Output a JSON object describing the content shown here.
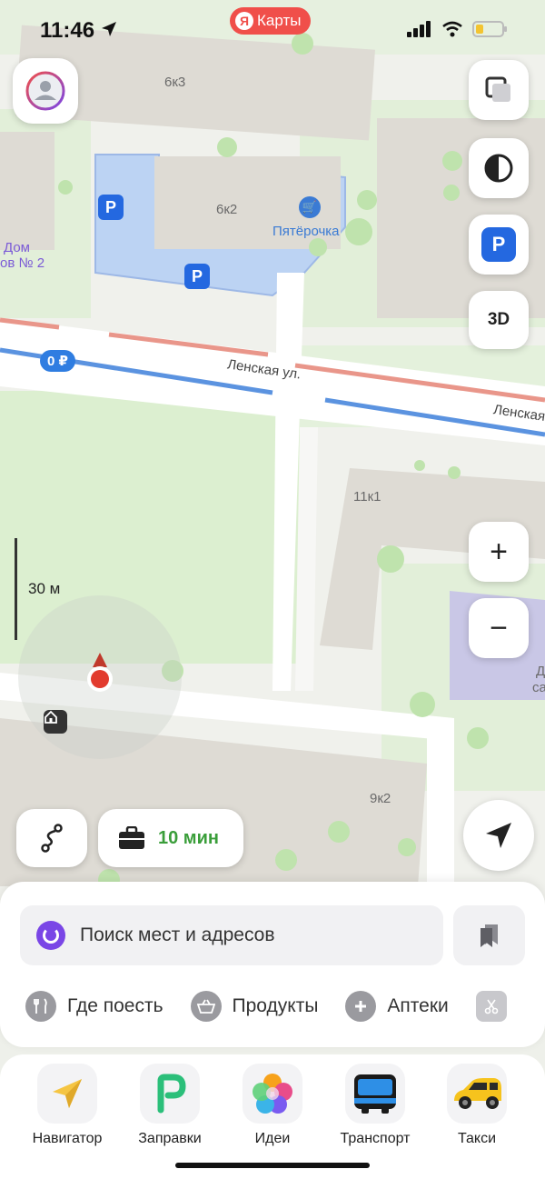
{
  "status_bar": {
    "time": "11:46",
    "app_badge": "Карты",
    "app_badge_logo": "Я",
    "badge_color": "#f04f4a"
  },
  "map": {
    "building_labels": [
      "6к3",
      "6к2",
      "11к1",
      "9к2"
    ],
    "poi_shop": "Пятёрочка",
    "poi_partial_left": [
      "Дом",
      "ов № 2"
    ],
    "poi_partial_right": [
      "Д",
      "са"
    ],
    "street_labels": [
      "Ленская ул.",
      "Ленская"
    ],
    "parking_price": "0 ₽",
    "parking_marker": "P",
    "scale": "30 м",
    "colors": {
      "parking_blue": "#2468e0",
      "road_blue": "#5b93e0",
      "road_red": "#e9968a",
      "grass": "#d6eccb"
    }
  },
  "controls": {
    "layers_icon": "layers-icon",
    "mode_icon": "half-circle-icon",
    "parking_button": "P",
    "three_d_button": "3D",
    "zoom_in": "+",
    "zoom_out": "−",
    "route_icon": "route-squiggle-icon",
    "work_route_time": "10 мин",
    "locate_icon": "navigation-arrow-icon"
  },
  "search": {
    "placeholder": "Поиск мест и адресов",
    "bookmarks_icon": "bookmarks-icon"
  },
  "categories": [
    {
      "label": "Где поесть",
      "icon": "fork-knife-icon"
    },
    {
      "label": "Продукты",
      "icon": "basket-icon"
    },
    {
      "label": "Аптеки",
      "icon": "plus-icon"
    }
  ],
  "dock": [
    {
      "label": "Навигатор",
      "icon": "navigator-icon"
    },
    {
      "label": "Заправки",
      "icon": "fuel-icon"
    },
    {
      "label": "Идеи",
      "icon": "ideas-icon"
    },
    {
      "label": "Транспорт",
      "icon": "bus-icon"
    },
    {
      "label": "Такси",
      "icon": "taxi-icon"
    }
  ]
}
